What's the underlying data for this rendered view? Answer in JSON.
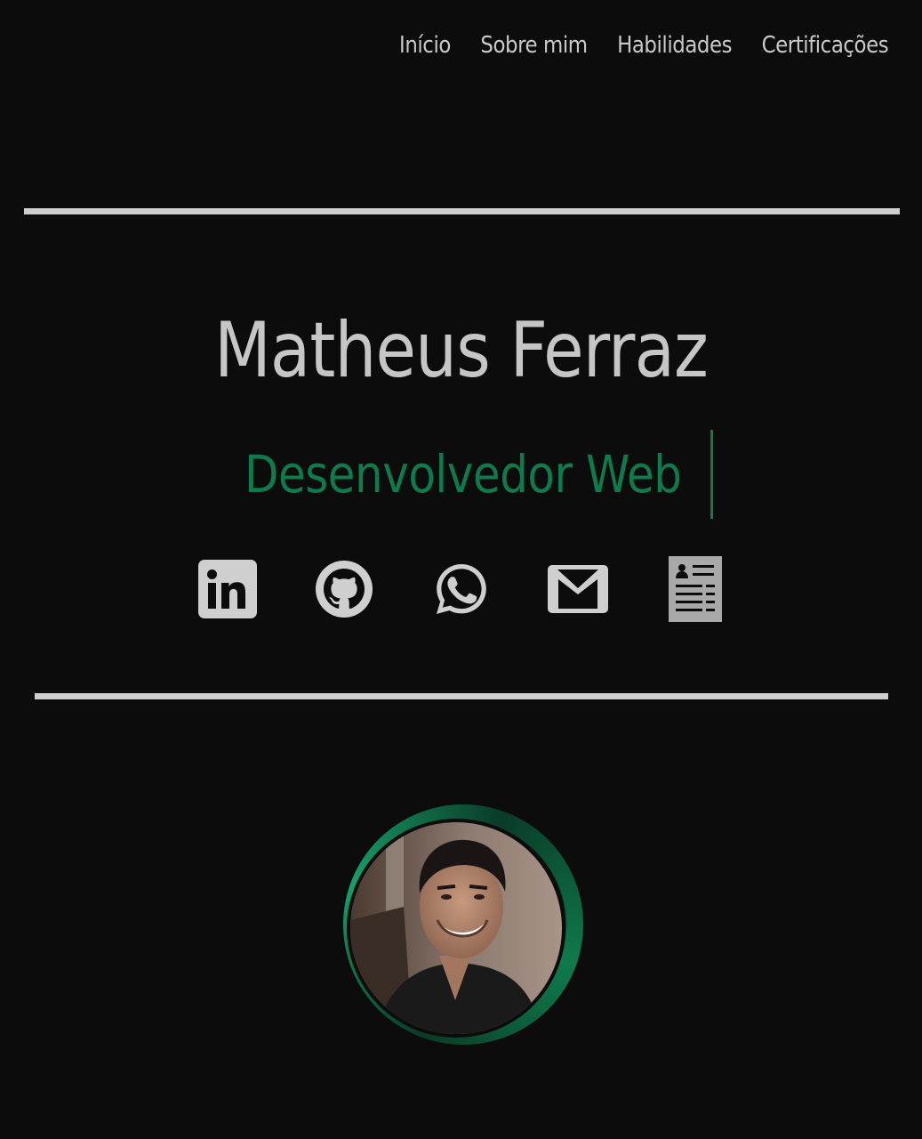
{
  "nav": {
    "items": [
      {
        "label": "Início"
      },
      {
        "label": "Sobre mim"
      },
      {
        "label": "Habilidades"
      },
      {
        "label": "Certificações"
      }
    ]
  },
  "hero": {
    "name": "Matheus Ferraz",
    "role": "Desenvolvedor Web"
  },
  "socials": [
    {
      "icon": "linkedin-icon"
    },
    {
      "icon": "github-icon"
    },
    {
      "icon": "whatsapp-icon"
    },
    {
      "icon": "email-icon"
    },
    {
      "icon": "resume-icon"
    }
  ],
  "colors": {
    "background": "#0c0c0d",
    "text": "#c9c9c9",
    "accent": "#0f7a4c"
  }
}
